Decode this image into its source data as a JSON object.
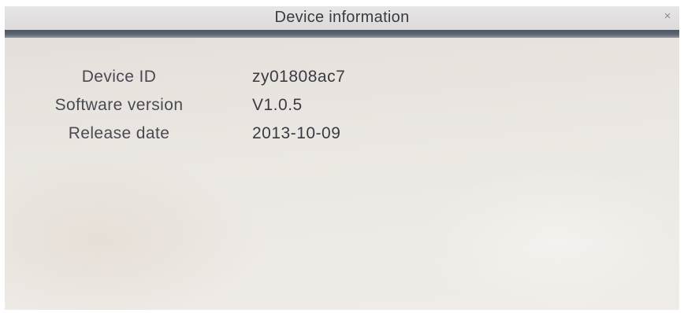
{
  "window": {
    "title": "Device information",
    "close_glyph": "×"
  },
  "rows": [
    {
      "label": "Device ID",
      "value": "zy01808ac7"
    },
    {
      "label": "Software version",
      "value": "V1.0.5"
    },
    {
      "label": "Release date",
      "value": "2013-10-09"
    }
  ],
  "colors": {
    "title_rule": "#55606b",
    "background": "#e8e3de",
    "text": "#44444c"
  },
  "icons": {
    "close": "close-icon"
  }
}
